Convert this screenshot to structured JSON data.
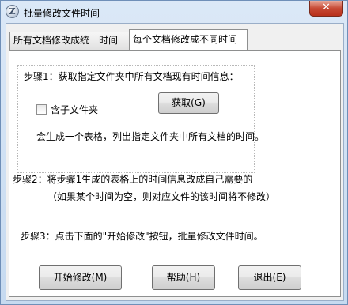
{
  "window": {
    "title": "批量修改文件时间",
    "app_icon_glyph": "Z",
    "close_glyph": "✕"
  },
  "tabs": [
    {
      "label": "所有文档修改成统一时间",
      "active": false
    },
    {
      "label": "每个文档修改成不同时间",
      "active": true
    }
  ],
  "step1": {
    "text": "步骤1：获取指定文件夹中所有文档现有时间信息：",
    "checkbox_label": "含子文件夹",
    "checkbox_checked": false,
    "get_button": "获取(G)",
    "note": "会生成一个表格，列出指定文件夹中所有文档的时间。"
  },
  "step2": {
    "text": "步骤2：将步骤1生成的表格上的时间信息改成自己需要的",
    "note": "（如果某个时间为空，则对应文件的该时间将不修改）"
  },
  "step3": {
    "text": "步骤3：点击下面的\"开始修改\"按钮，批量修改文件时间。"
  },
  "buttons": {
    "start": "开始修改(M)",
    "help": "帮助(H)",
    "exit": "退出(E)"
  },
  "colors": {
    "highlight_ellipse": "#4a5ec8",
    "close_button": "#c74a35"
  }
}
